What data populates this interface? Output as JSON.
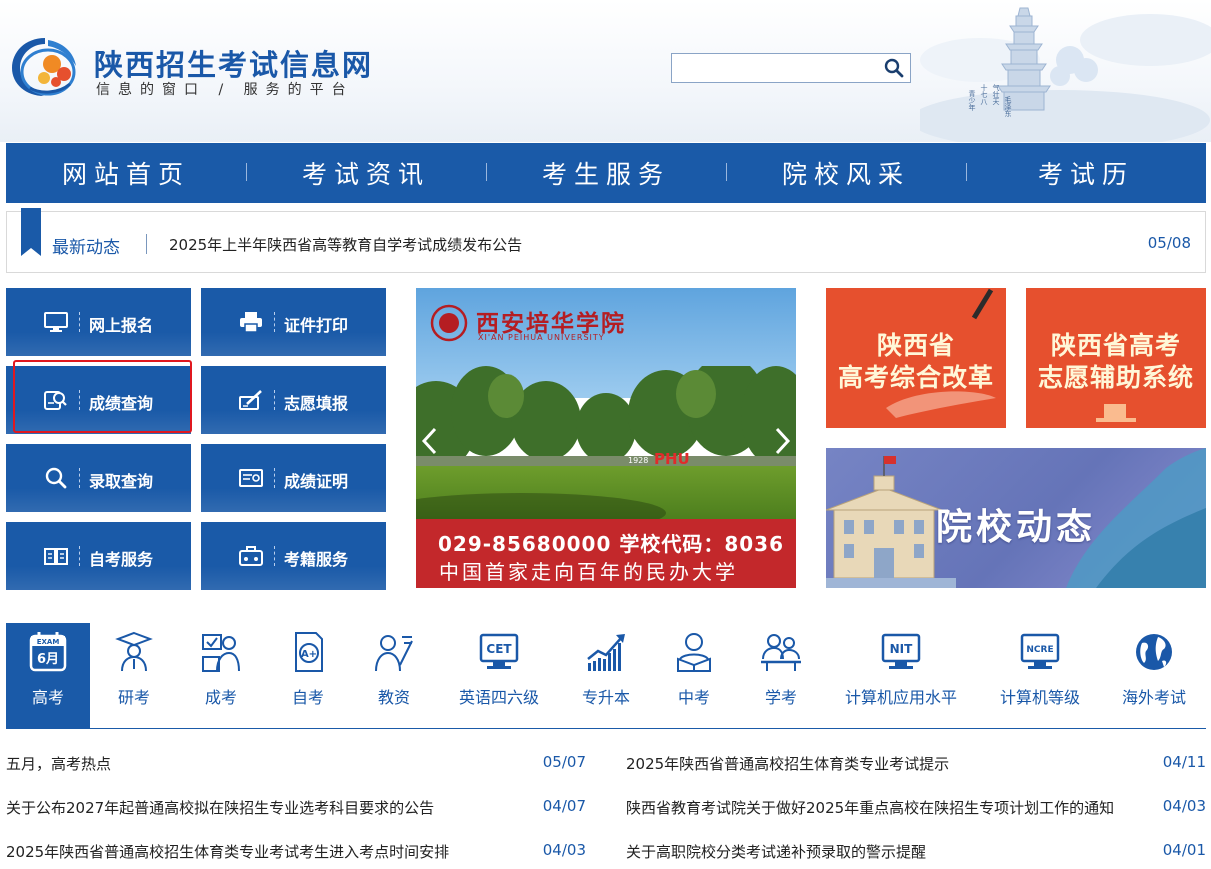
{
  "header": {
    "title": "陕西招生考试信息网",
    "slogan": "信息的窗口 / 服务的平台",
    "search": {
      "value": "",
      "placeholder": ""
    },
    "deco_poem": [
      "青少年",
      "十七八",
      "气壮天",
      "毛泽东",
      "志超越"
    ]
  },
  "nav": {
    "items": [
      "网站首页",
      "考试资讯",
      "考生服务",
      "院校风采",
      "考试历"
    ]
  },
  "ticker": {
    "label": "最新动态",
    "text": "2025年上半年陕西省高等教育自学考试成绩发布公告",
    "date": "05/08"
  },
  "tiles": [
    {
      "label": "网上报名",
      "icon": "monitor-icon"
    },
    {
      "label": "证件打印",
      "icon": "printer-icon"
    },
    {
      "label": "成绩查询",
      "icon": "score-search-icon"
    },
    {
      "label": "志愿填报",
      "icon": "form-pen-icon"
    },
    {
      "label": "录取查询",
      "icon": "magnifier-icon"
    },
    {
      "label": "成绩证明",
      "icon": "certificate-icon"
    },
    {
      "label": "自考服务",
      "icon": "book-icon"
    },
    {
      "label": "考籍服务",
      "icon": "briefcase-icon"
    }
  ],
  "carousel": {
    "school_name": "西安培华学院",
    "school_name_en": "XI'AN PEIHUA UNIVERSITY",
    "sign": "PHU",
    "sign_year": "1928",
    "phone_line": "029-85680000  学校代码：8036",
    "slogan": "中国首家走向百年的民办大学",
    "prev_icon": "chevron-left-icon",
    "next_icon": "chevron-right-icon"
  },
  "promos": {
    "reform": {
      "line1": "陕西省",
      "line2": "高考综合改革"
    },
    "volunteer": {
      "line1": "陕西省高考",
      "line2": "志愿辅助系统"
    },
    "college": {
      "text": "院校动态"
    }
  },
  "categories": [
    {
      "label": "高考",
      "icon": "exam-calendar-icon",
      "badge_top": "EXAM",
      "badge": "6月",
      "active": true
    },
    {
      "label": "研考",
      "icon": "graduate-icon"
    },
    {
      "label": "成考",
      "icon": "adult-exam-icon"
    },
    {
      "label": "自考",
      "icon": "self-study-icon"
    },
    {
      "label": "教资",
      "icon": "teacher-icon"
    },
    {
      "label": "英语四六级",
      "icon": "cet-icon",
      "badge": "CET"
    },
    {
      "label": "专升本",
      "icon": "growth-chart-icon"
    },
    {
      "label": "中考",
      "icon": "student-reading-icon"
    },
    {
      "label": "学考",
      "icon": "students-icon"
    },
    {
      "label": "计算机应用水平",
      "icon": "nit-icon",
      "badge": "NIT"
    },
    {
      "label": "计算机等级",
      "icon": "ncre-icon",
      "badge": "NCRE"
    },
    {
      "label": "海外考试",
      "icon": "globe-icon"
    }
  ],
  "news_left": [
    {
      "title": "五月，高考热点",
      "date": "05/07"
    },
    {
      "title": "关于公布2027年起普通高校拟在陕招生专业选考科目要求的公告",
      "date": "04/07"
    },
    {
      "title": "2025年陕西省普通高校招生体育类专业考试考生进入考点时间安排",
      "date": "04/03"
    }
  ],
  "news_right": [
    {
      "title": "2025年陕西省普通高校招生体育类专业考试提示",
      "date": "04/11"
    },
    {
      "title": "陕西省教育考试院关于做好2025年重点高校在陕招生专项计划工作的通知",
      "date": "04/03"
    },
    {
      "title": "关于高职院校分类考试递补预录取的警示提醒",
      "date": "04/01"
    }
  ],
  "colors": {
    "brand_blue": "#1a5aa8",
    "promo_orange": "#e6502e",
    "carousel_red": "#c3282b",
    "highlight_red": "#e0181f"
  }
}
